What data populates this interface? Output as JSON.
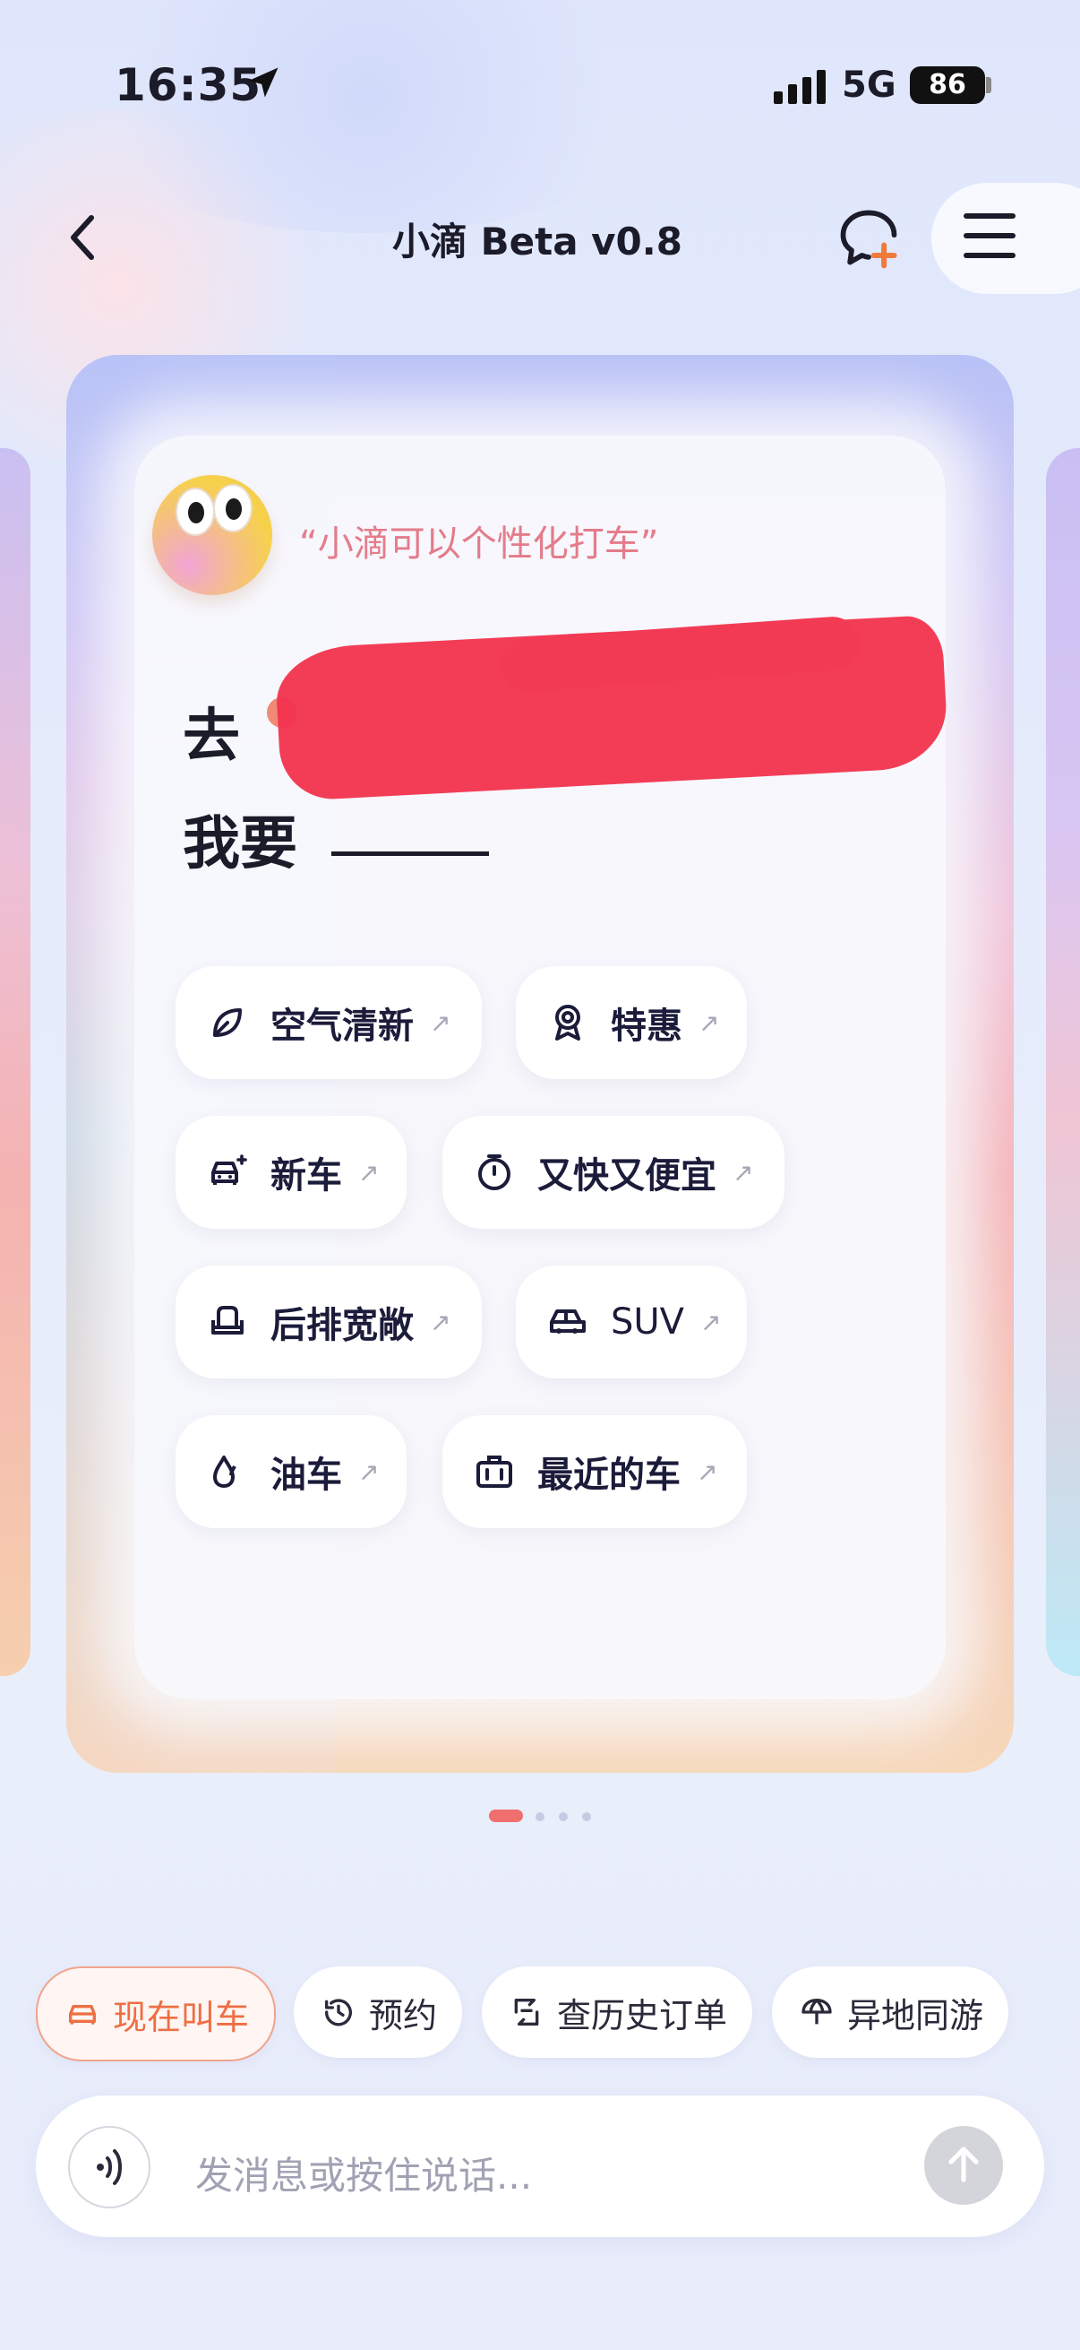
{
  "status_bar": {
    "time": "16:35",
    "network": "5G",
    "battery": "86"
  },
  "nav": {
    "title": "小滴 Beta v0.8"
  },
  "card": {
    "quote": "“小滴可以个性化打车”",
    "dest_prefix": "去",
    "need_prefix": "我要",
    "options": [
      {
        "label": "空气清新",
        "icon": "leaf-icon"
      },
      {
        "label": "特惠",
        "icon": "award-icon"
      },
      {
        "label": "新车",
        "icon": "car-sparkle-icon"
      },
      {
        "label": "又快又便宜",
        "icon": "timer-icon"
      },
      {
        "label": "后排宽敞",
        "icon": "seat-icon"
      },
      {
        "label": "SUV",
        "icon": "suv-icon"
      },
      {
        "label": "油车",
        "icon": "fuel-drop-icon"
      },
      {
        "label": "最近的车",
        "icon": "luggage-icon"
      }
    ],
    "arrow": "↗"
  },
  "pagination": {
    "count": 4,
    "active": 1
  },
  "quick_actions": [
    {
      "label": "现在叫车",
      "icon": "car-icon"
    },
    {
      "label": "预约",
      "icon": "clock-icon"
    },
    {
      "label": "查历史订单",
      "icon": "history-order-icon"
    },
    {
      "label": "异地同游",
      "icon": "umbrella-icon"
    }
  ],
  "input": {
    "placeholder": "发消息或按住说话..."
  },
  "colors": {
    "accent": "#ee6f44",
    "quote": "#e47c8a",
    "active_dot": "#ef6e6e"
  }
}
